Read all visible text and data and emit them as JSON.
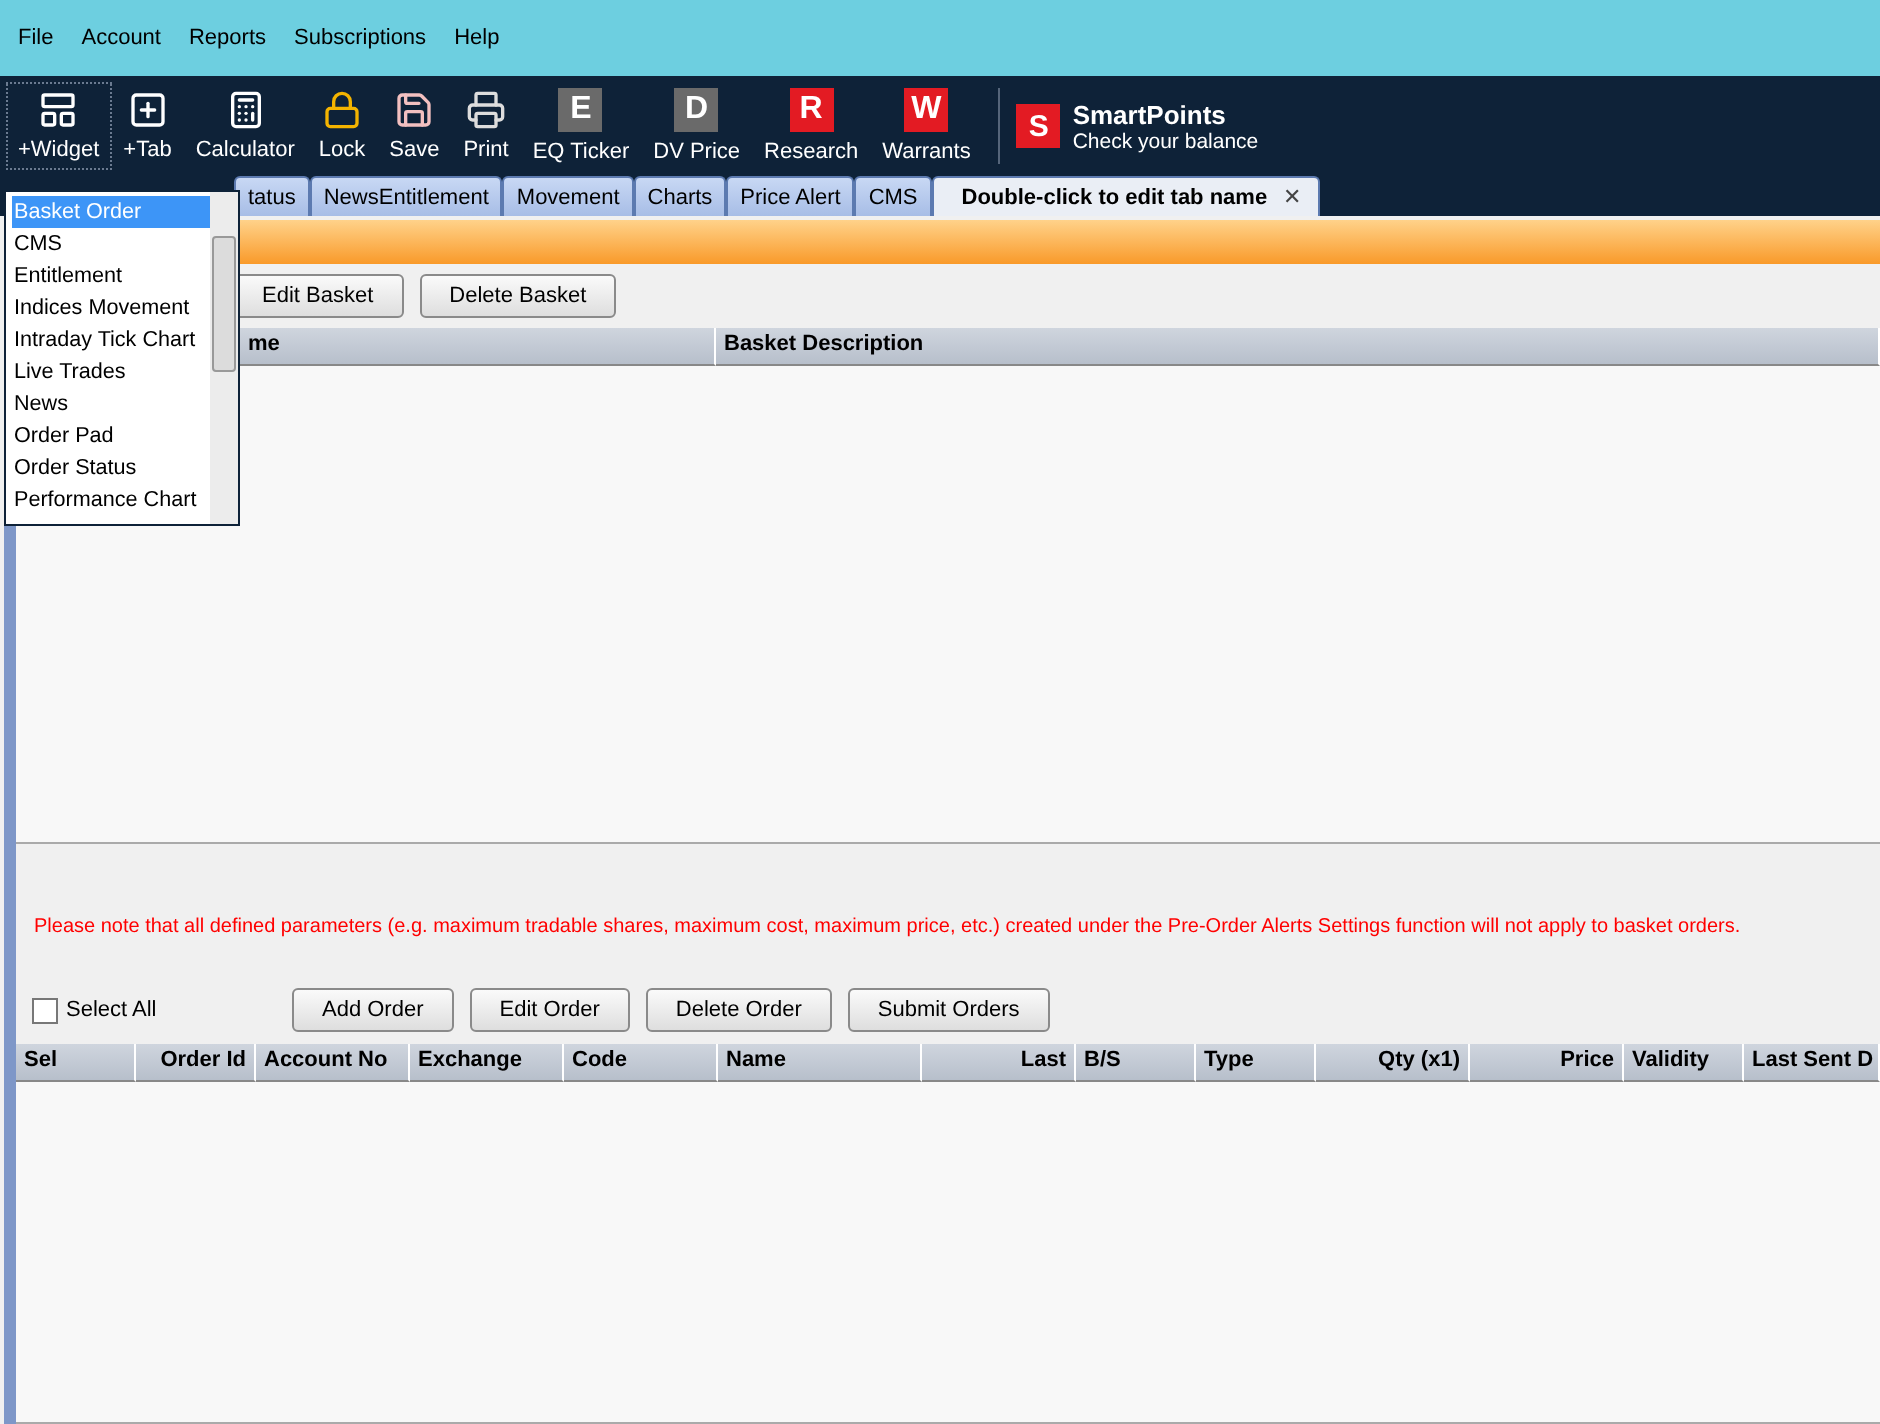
{
  "menu": [
    "File",
    "Account",
    "Reports",
    "Subscriptions",
    "Help"
  ],
  "toolbar": [
    {
      "kind": "widget",
      "label": "+Widget",
      "selected": true
    },
    {
      "kind": "tab",
      "label": "+Tab",
      "selected": false
    },
    {
      "kind": "calculator",
      "label": "Calculator",
      "selected": false
    },
    {
      "kind": "lock",
      "label": "Lock",
      "selected": false
    },
    {
      "kind": "save",
      "label": "Save",
      "selected": false
    },
    {
      "kind": "print",
      "label": "Print",
      "selected": false
    },
    {
      "kind": "ticker",
      "letter": "E",
      "label": "EQ Ticker",
      "selected": false
    },
    {
      "kind": "ticker",
      "letter": "D",
      "label": "DV Price",
      "selected": false
    },
    {
      "kind": "letter",
      "letter": "R",
      "label": "Research",
      "selected": false
    },
    {
      "kind": "letter",
      "letter": "W",
      "label": "Warrants",
      "selected": false
    }
  ],
  "smartpoints": {
    "logo": "S",
    "title": "SmartPoints",
    "subtitle": "Check your balance"
  },
  "tabs": [
    {
      "label": "tatus",
      "selected": false
    },
    {
      "label": "NewsEntitlement",
      "selected": false
    },
    {
      "label": "Movement",
      "selected": false
    },
    {
      "label": "Charts",
      "selected": false
    },
    {
      "label": "Price Alert",
      "selected": false
    },
    {
      "label": "CMS",
      "selected": false
    },
    {
      "label": "Double-click to edit tab name",
      "selected": true,
      "close": "✕"
    }
  ],
  "widget_dropdown": [
    {
      "label": "Basket Order",
      "selected": true
    },
    {
      "label": "CMS",
      "selected": false
    },
    {
      "label": "Entitlement",
      "selected": false
    },
    {
      "label": "Indices Movement",
      "selected": false
    },
    {
      "label": "Intraday Tick Chart",
      "selected": false
    },
    {
      "label": "Live Trades",
      "selected": false
    },
    {
      "label": "News",
      "selected": false
    },
    {
      "label": "Order Pad",
      "selected": false
    },
    {
      "label": "Order Status",
      "selected": false
    },
    {
      "label": "Performance Chart",
      "selected": false
    }
  ],
  "basket_buttons": [
    "Edit Basket",
    "Delete Basket"
  ],
  "basket_table": {
    "columns": [
      "me",
      "Basket Description"
    ]
  },
  "note": "Please note that all defined parameters (e.g. maximum tradable shares, maximum cost, maximum price, etc.) created under the Pre-Order Alerts Settings function will not apply to basket orders.",
  "select_all": {
    "label": "Select All",
    "checked": false
  },
  "order_buttons": [
    "Add Order",
    "Edit Order",
    "Delete Order",
    "Submit Orders"
  ],
  "order_table": {
    "columns": [
      {
        "label": "Sel",
        "kind": "text"
      },
      {
        "label": "Order Id",
        "kind": "number"
      },
      {
        "label": "Account No",
        "kind": "text"
      },
      {
        "label": "Exchange",
        "kind": "text"
      },
      {
        "label": "Code",
        "kind": "text"
      },
      {
        "label": "Name",
        "kind": "text"
      },
      {
        "label": "Last",
        "kind": "number"
      },
      {
        "label": "B/S",
        "kind": "text"
      },
      {
        "label": "Type",
        "kind": "text"
      },
      {
        "label": "Qty (x1)",
        "kind": "number"
      },
      {
        "label": "Price",
        "kind": "number"
      },
      {
        "label": "Validity",
        "kind": "text"
      },
      {
        "label": "Last Sent D",
        "kind": "text"
      }
    ]
  }
}
